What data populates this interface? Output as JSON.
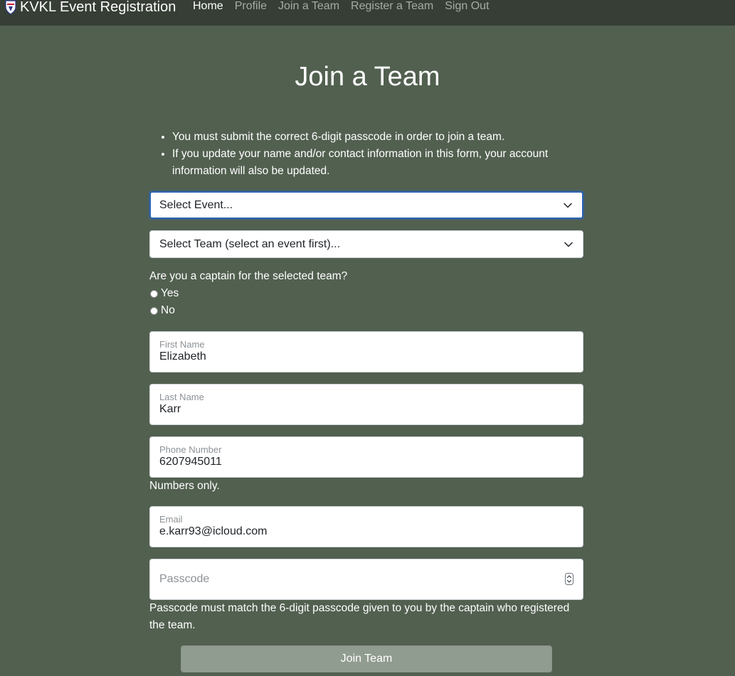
{
  "brand": {
    "title": "KVKL Event Registration"
  },
  "nav": {
    "items": [
      {
        "label": "Home",
        "active": true
      },
      {
        "label": "Profile"
      },
      {
        "label": "Join a Team"
      },
      {
        "label": "Register a Team"
      },
      {
        "label": "Sign Out"
      }
    ]
  },
  "page": {
    "title": "Join a Team"
  },
  "notes": [
    "You must submit the correct 6-digit passcode in order to join a team.",
    "If you update your name and/or contact information in this form, your account information will also be updated."
  ],
  "event_select": {
    "value": "Select Event..."
  },
  "team_select": {
    "value": "Select Team (select an event first)..."
  },
  "captain": {
    "question": "Are you a captain for the selected team?",
    "yes_label": "Yes",
    "no_label": "No"
  },
  "fields": {
    "first_name": {
      "label": "First Name",
      "value": "Elizabeth"
    },
    "last_name": {
      "label": "Last Name",
      "value": "Karr"
    },
    "phone": {
      "label": "Phone Number",
      "value": "6207945011",
      "help": "Numbers only."
    },
    "email": {
      "label": "Email",
      "value": "e.karr93@icloud.com"
    },
    "passcode": {
      "placeholder": "Passcode",
      "help": "Passcode must match the 6-digit passcode given to you by the captain who registered the team."
    }
  },
  "submit": {
    "label": "Join Team"
  },
  "colors": {
    "page_bg": "#526050",
    "navbar_bg": "#363e35",
    "button_bg": "#919c90",
    "focus_border": "#2a63b5"
  }
}
